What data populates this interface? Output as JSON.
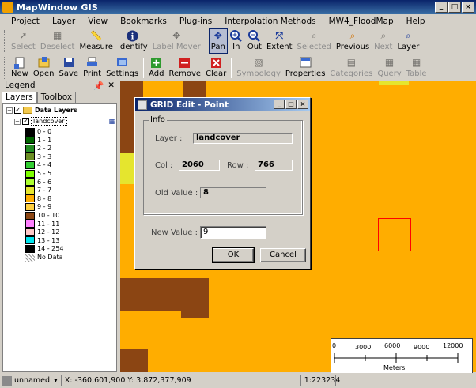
{
  "window": {
    "title": "MapWindow GIS"
  },
  "menu": [
    "Project",
    "Layer",
    "View",
    "Bookmarks",
    "Plug-ins",
    "Interpolation Methods",
    "MW4_FloodMap",
    "Help"
  ],
  "toolbar1": [
    {
      "label": "Select",
      "icon": "select-arrow-icon",
      "state": "disabled"
    },
    {
      "label": "Deselect",
      "icon": "deselect-icon",
      "state": "disabled"
    },
    {
      "label": "Measure",
      "icon": "measure-ruler-icon",
      "state": "enabled"
    },
    {
      "label": "Identify",
      "icon": "info-icon",
      "state": "enabled"
    },
    {
      "label": "Label Mover",
      "icon": "label-mover-icon",
      "state": "disabled"
    },
    {
      "label": "Pan",
      "icon": "pan-arrows-icon",
      "state": "active"
    },
    {
      "label": "In",
      "icon": "zoom-in-icon",
      "state": "enabled"
    },
    {
      "label": "Out",
      "icon": "zoom-out-icon",
      "state": "enabled"
    },
    {
      "label": "Extent",
      "icon": "full-extent-icon",
      "state": "enabled"
    },
    {
      "label": "Selected",
      "icon": "zoom-selected-icon",
      "state": "disabled"
    },
    {
      "label": "Previous",
      "icon": "zoom-previous-icon",
      "state": "enabled"
    },
    {
      "label": "Next",
      "icon": "zoom-next-icon",
      "state": "disabled"
    },
    {
      "label": "Layer",
      "icon": "zoom-layer-icon",
      "state": "enabled"
    }
  ],
  "toolbar2": [
    {
      "label": "New",
      "icon": "new-file-icon",
      "state": "enabled"
    },
    {
      "label": "Open",
      "icon": "open-folder-icon",
      "state": "enabled"
    },
    {
      "label": "Save",
      "icon": "save-disk-icon",
      "state": "enabled"
    },
    {
      "label": "Print",
      "icon": "printer-icon",
      "state": "enabled"
    },
    {
      "label": "Settings",
      "icon": "settings-icon",
      "state": "enabled"
    },
    {
      "label": "Add",
      "icon": "add-layer-icon",
      "state": "enabled"
    },
    {
      "label": "Remove",
      "icon": "remove-layer-icon",
      "state": "enabled"
    },
    {
      "label": "Clear",
      "icon": "clear-layers-icon",
      "state": "enabled"
    },
    {
      "label": "Symbology",
      "icon": "symbology-icon",
      "state": "disabled"
    },
    {
      "label": "Properties",
      "icon": "properties-icon",
      "state": "enabled"
    },
    {
      "label": "Categories",
      "icon": "categories-icon",
      "state": "disabled"
    },
    {
      "label": "Query",
      "icon": "query-icon",
      "state": "disabled"
    },
    {
      "label": "Table",
      "icon": "table-icon",
      "state": "disabled"
    }
  ],
  "legend": {
    "title": "Legend",
    "tabs": [
      "Layers",
      "Toolbox"
    ],
    "group": "Data Layers",
    "layer": "landcover",
    "classes": [
      {
        "label": "0 - 0",
        "color": "#000000"
      },
      {
        "label": "1 - 1",
        "color": "#006400"
      },
      {
        "label": "2 - 2",
        "color": "#228b22"
      },
      {
        "label": "3 - 3",
        "color": "#6b8e23"
      },
      {
        "label": "4 - 4",
        "color": "#32cd32"
      },
      {
        "label": "5 - 5",
        "color": "#7fff00"
      },
      {
        "label": "6 - 6",
        "color": "#adff2f"
      },
      {
        "label": "7 - 7",
        "color": "#e5e52e"
      },
      {
        "label": "8 - 8",
        "color": "#ffad00"
      },
      {
        "label": "9 - 9",
        "color": "#ffd040"
      },
      {
        "label": "10 - 10",
        "color": "#8b4513"
      },
      {
        "label": "11 - 11",
        "color": "#ff80ff"
      },
      {
        "label": "12 - 12",
        "color": "#ffc8c8"
      },
      {
        "label": "13 - 13",
        "color": "#00e5ee"
      },
      {
        "label": "14 - 254",
        "color": "#000000"
      },
      {
        "label": "No Data",
        "color": "hatch"
      }
    ]
  },
  "dialog": {
    "title": "GRID Edit - Point",
    "group_title": "Info",
    "layer_label": "Layer :",
    "layer_value": "landcover",
    "col_label": "Col :",
    "col_value": "2060",
    "row_label": "Row :",
    "row_value": "766",
    "old_label": "Old Value :",
    "old_value": "8",
    "new_label": "New Value :",
    "new_value": "9",
    "ok_label": "OK",
    "cancel_label": "Cancel"
  },
  "scalebar": {
    "ticks": [
      "0",
      "3000",
      "6000",
      "9000",
      "12000"
    ],
    "unit": "Meters"
  },
  "status": {
    "project": "unnamed",
    "coords": "X: -360,601,900 Y: 3,872,377,909",
    "scale": "1:223234"
  },
  "colors": {
    "map_background": "#ffad00",
    "brown_class": "#8b4513",
    "yellow_class": "#e5e52e",
    "selection_box": "#ff0000"
  }
}
